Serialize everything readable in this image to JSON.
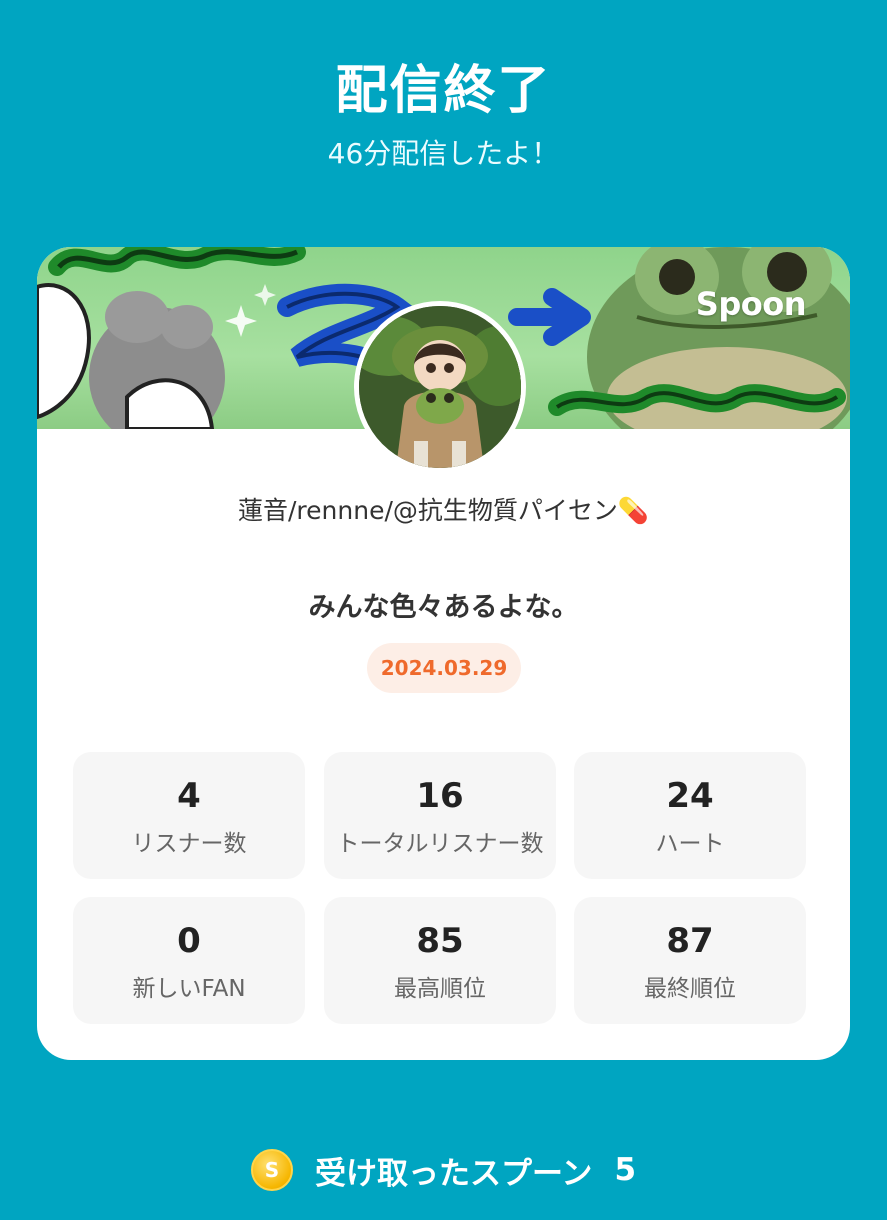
{
  "header": {
    "title": "配信終了",
    "subtitle": "46分配信したよ！"
  },
  "card": {
    "brand": "Spoon",
    "username": "蓮音/rennne/@抗生物質パイセン💊",
    "stream_title": "みんな色々あるよな。",
    "date": "2024.03.29",
    "stats": [
      {
        "value": "4",
        "label": "リスナー数"
      },
      {
        "value": "16",
        "label": "トータルリスナー数"
      },
      {
        "value": "24",
        "label": "ハート"
      },
      {
        "value": "0",
        "label": "新しいFAN"
      },
      {
        "value": "85",
        "label": "最高順位"
      },
      {
        "value": "87",
        "label": "最終順位"
      }
    ]
  },
  "footer": {
    "coin_symbol": "S",
    "spoons_label": "受け取ったスプーン",
    "spoons_count": "5"
  },
  "colors": {
    "background": "#00a5c1",
    "date_badge_text": "#ef6a2c",
    "date_badge_bg": "#fdeee6"
  }
}
